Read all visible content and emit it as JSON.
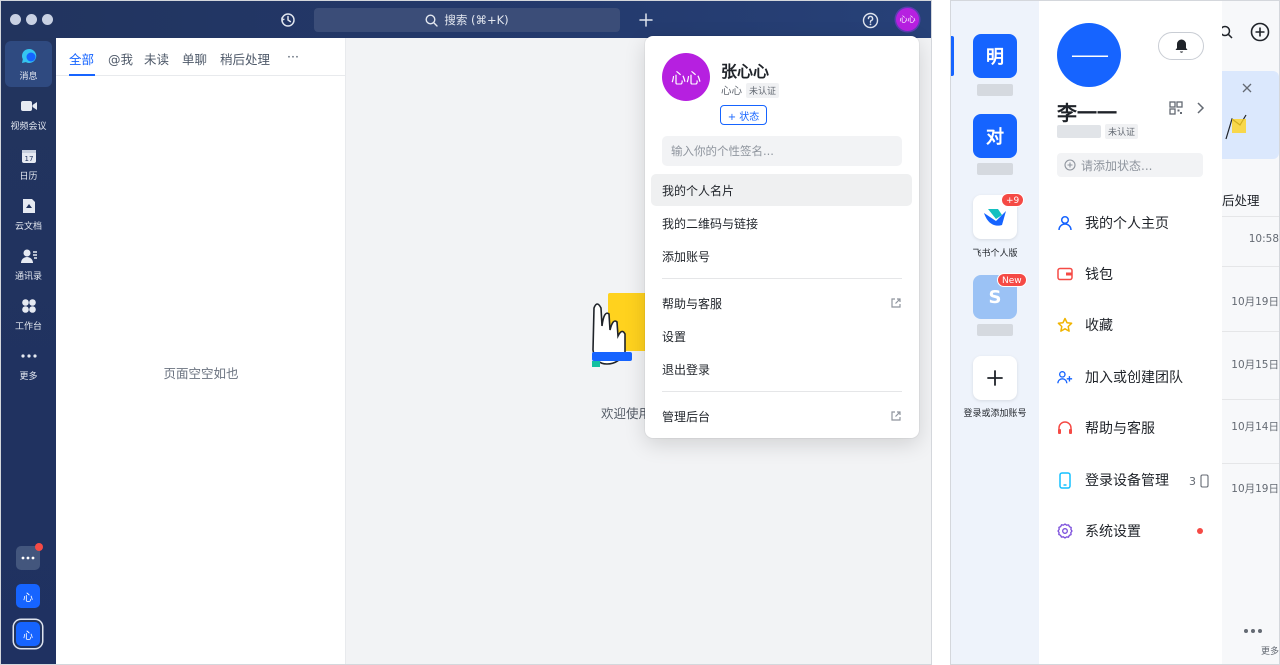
{
  "desktop": {
    "search_label": "搜索 (⌘+K)",
    "avatar_text": "心心",
    "rail": [
      {
        "label": "消息",
        "icon": "message-icon",
        "active": true
      },
      {
        "label": "视频会议",
        "icon": "video-icon"
      },
      {
        "label": "日历",
        "icon": "calendar-icon",
        "day": "17"
      },
      {
        "label": "云文档",
        "icon": "docs-icon"
      },
      {
        "label": "通讯录",
        "icon": "contacts-icon"
      },
      {
        "label": "工作台",
        "icon": "workplace-icon"
      },
      {
        "label": "更多",
        "icon": "more-icon"
      }
    ],
    "rail_bottom": {
      "app1": "心",
      "app2": "心"
    },
    "tabs": [
      "全部",
      "@我",
      "未读",
      "单聊",
      "稍后处理",
      "···"
    ],
    "empty_text": "页面空空如也",
    "welcome_text": "欢迎使用",
    "dropdown": {
      "name": "张心心",
      "nickname": "心心",
      "verify_badge": "未认证",
      "status_button": "+ 状态",
      "sign_placeholder": "输入你的个性签名...",
      "items_group1": [
        "我的个人名片",
        "我的二维码与链接",
        "添加账号"
      ],
      "items_group2": [
        "帮助与客服",
        "设置",
        "退出登录"
      ],
      "items_group3": [
        "管理后台"
      ]
    }
  },
  "mobile": {
    "accounts": [
      {
        "char": "明",
        "color": "#1664ff"
      },
      {
        "char": "对",
        "color": "#1664ff"
      },
      {
        "label": "飞书个人版",
        "badge": "+9"
      },
      {
        "char": "S",
        "color": "#9bc2f5",
        "badge": "New"
      },
      {
        "label": "登录或添加账号"
      }
    ],
    "profile": {
      "avatar_text": "——",
      "name": "李一一",
      "verify_badge": "未认证",
      "status_placeholder": "请添加状态...",
      "menu": [
        {
          "label": "我的个人主页",
          "icon": "person-icon",
          "color": "#1664ff"
        },
        {
          "label": "钱包",
          "icon": "wallet-icon",
          "color": "#f54a45"
        },
        {
          "label": "收藏",
          "icon": "star-icon",
          "color": "#f0b400"
        },
        {
          "label": "加入或创建团队",
          "icon": "team-icon",
          "color": "#1664ff"
        },
        {
          "label": "帮助与客服",
          "icon": "headset-icon",
          "color": "#f54a45"
        },
        {
          "label": "登录设备管理",
          "icon": "device-icon",
          "color": "#14c0ff",
          "count": "3"
        },
        {
          "label": "系统设置",
          "icon": "settings-icon",
          "color": "#7a4ddb"
        }
      ]
    },
    "overflow": {
      "tab_text": "后处理",
      "times": [
        "10:58",
        "10月19日",
        "10月15日",
        "10月14日",
        "10月19日"
      ],
      "more_label": "更多"
    }
  }
}
